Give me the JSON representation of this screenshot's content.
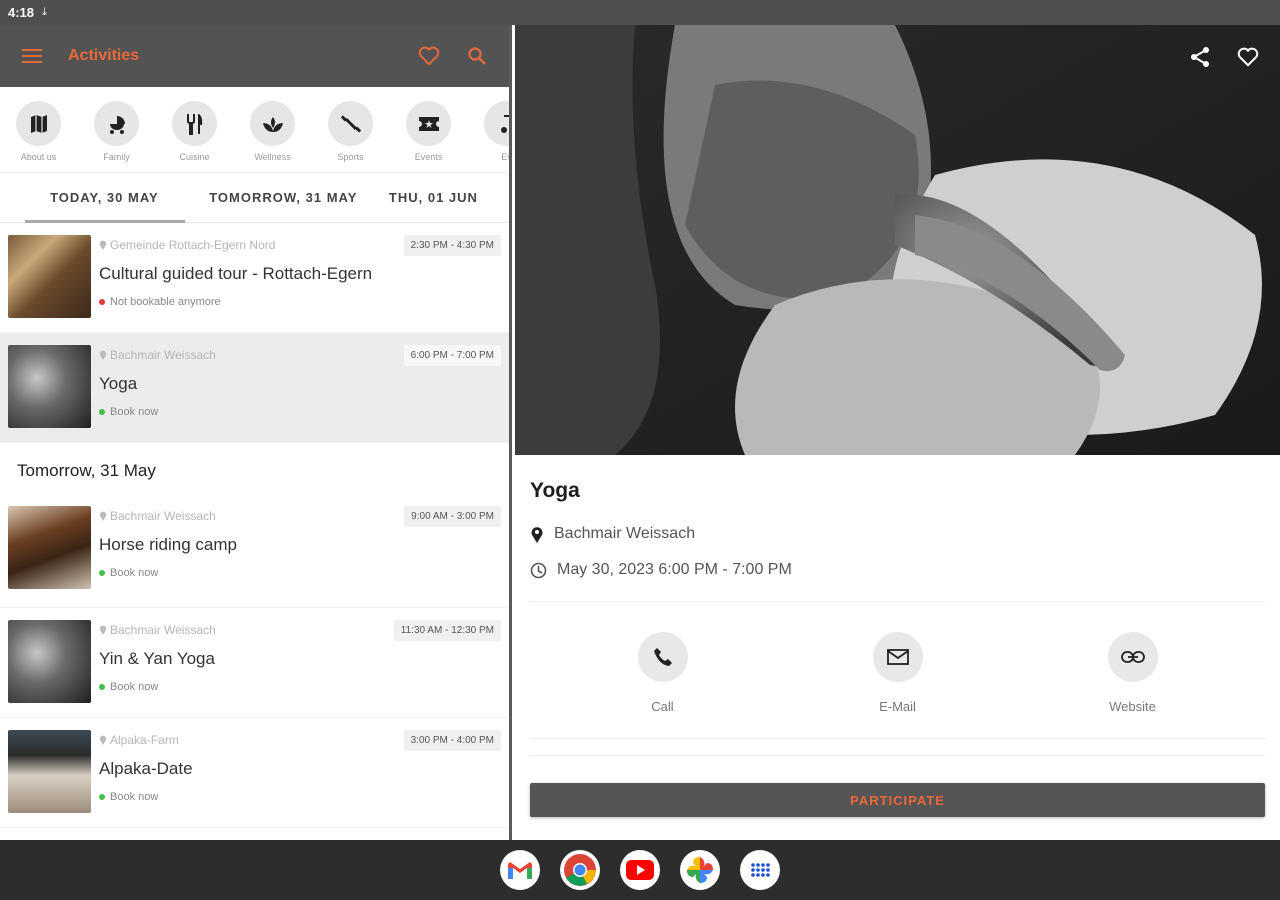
{
  "status_bar": {
    "time": "4:18"
  },
  "left": {
    "title": "Activities",
    "categories": [
      {
        "label": "About us",
        "icon": "map-icon"
      },
      {
        "label": "Family",
        "icon": "stroller-icon"
      },
      {
        "label": "Cuisine",
        "icon": "cutlery-icon"
      },
      {
        "label": "Wellness",
        "icon": "spa-icon"
      },
      {
        "label": "Sports",
        "icon": "fitness-icon"
      },
      {
        "label": "Events",
        "icon": "ticket-icon"
      },
      {
        "label": "Ev",
        "icon": "music-icon"
      }
    ],
    "tabs": [
      "TODAY, 30 MAY",
      "TOMORROW, 31 MAY",
      "THU, 01 JUN"
    ],
    "today": [
      {
        "location": "Gemeinde Rottach-Egern Nord",
        "time": "2:30 PM - 4:30 PM",
        "title": "Cultural guided tour - Rottach-Egern",
        "status": "Not bookable anymore",
        "status_color": "#e53935"
      },
      {
        "location": "Bachmair Weissach",
        "time": "6:00 PM - 7:00 PM",
        "title": "Yoga",
        "status": "Book now",
        "status_color": "#43c04a"
      }
    ],
    "tomorrow_header": "Tomorrow, 31 May",
    "tomorrow": [
      {
        "location": "Bachmair Weissach",
        "time": "9:00 AM - 3:00 PM",
        "title": "Horse riding camp",
        "status": "Book now",
        "status_color": "#43c04a"
      },
      {
        "location": "Bachmair Weissach",
        "time": "11:30 AM - 12:30 PM",
        "title": "Yin & Yan Yoga",
        "status": "Book now",
        "status_color": "#43c04a"
      },
      {
        "location": "Alpaka-Farm",
        "time": "3:00 PM - 4:00 PM",
        "title": "Alpaka-Date",
        "status": "Book now",
        "status_color": "#43c04a"
      }
    ]
  },
  "detail": {
    "title": "Yoga",
    "location": "Bachmair Weissach",
    "datetime": "May 30, 2023 6:00 PM - 7:00 PM",
    "contacts": [
      {
        "label": "Call",
        "icon": "phone-icon"
      },
      {
        "label": "E-Mail",
        "icon": "mail-icon"
      },
      {
        "label": "Website",
        "icon": "link-icon"
      }
    ],
    "participate": "PARTICIPATE"
  },
  "colors": {
    "accent": "#e8693a",
    "appbar": "#535353"
  }
}
